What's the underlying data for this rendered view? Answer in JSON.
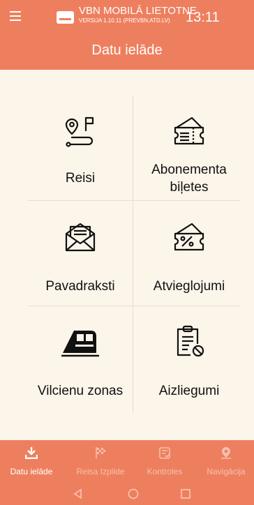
{
  "header": {
    "app_name": "VBN MOBILĀ LIETOTNE",
    "version": "VERSIJA 1.10.11 (PREVBN.ATD.LV)",
    "time": "13:11",
    "title": "Datu ielāde"
  },
  "tiles": [
    {
      "label": "Reisi",
      "icon": "route-icon"
    },
    {
      "label_line1": "Abonementa",
      "label_line2": "biļetes",
      "icon": "ticket-icon"
    },
    {
      "label": "Pavadraksti",
      "icon": "envelope-icon"
    },
    {
      "label": "Atvieglojumi",
      "icon": "discount-ticket-icon"
    },
    {
      "label": "Vilcienu zonas",
      "icon": "train-icon"
    },
    {
      "label": "Aizliegumi",
      "icon": "clipboard-ban-icon"
    }
  ],
  "bottom_nav": {
    "items": [
      {
        "label": "Datu ielāde",
        "icon": "download-icon",
        "active": true
      },
      {
        "label": "Reisa Izpilde",
        "icon": "checkered-flag-icon",
        "active": false
      },
      {
        "label": "Kontroles",
        "icon": "ticket-check-icon",
        "active": false
      },
      {
        "label": "Navigācija",
        "icon": "location-pin-icon",
        "active": false
      }
    ]
  },
  "colors": {
    "accent": "#ee7f5e",
    "background": "#fbf5ea",
    "active_nav_text": "#ffffff",
    "inactive_nav_text": "#f5c0ad"
  }
}
